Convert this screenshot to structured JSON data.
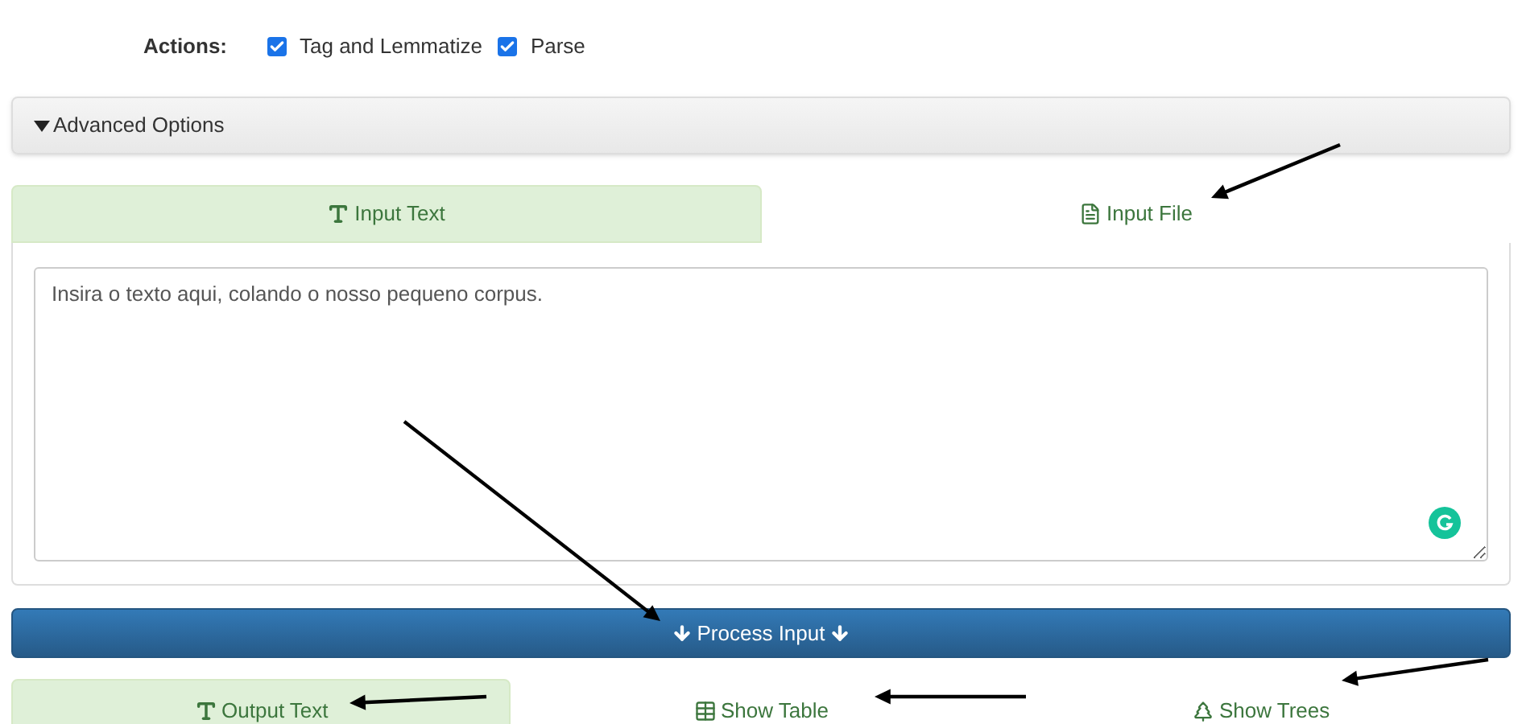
{
  "actions": {
    "label": "Actions:",
    "options": [
      {
        "label": "Tag and Lemmatize",
        "checked": true
      },
      {
        "label": "Parse",
        "checked": true
      }
    ]
  },
  "advanced_options": {
    "label": "Advanced Options",
    "expanded": false
  },
  "input_tabs": [
    {
      "kind": "font",
      "label": "Input Text",
      "selected": true
    },
    {
      "kind": "file",
      "label": "Input File",
      "selected": false
    }
  ],
  "input_text": {
    "value": "Insira o texto aqui, colando o nosso pequeno corpus."
  },
  "process_button": {
    "label": "Process Input"
  },
  "output_tabs": [
    {
      "kind": "font",
      "label": "Output Text",
      "selected": true
    },
    {
      "kind": "table",
      "label": "Show Table",
      "selected": false
    },
    {
      "kind": "tree",
      "label": "Show Trees",
      "selected": false
    }
  ]
}
